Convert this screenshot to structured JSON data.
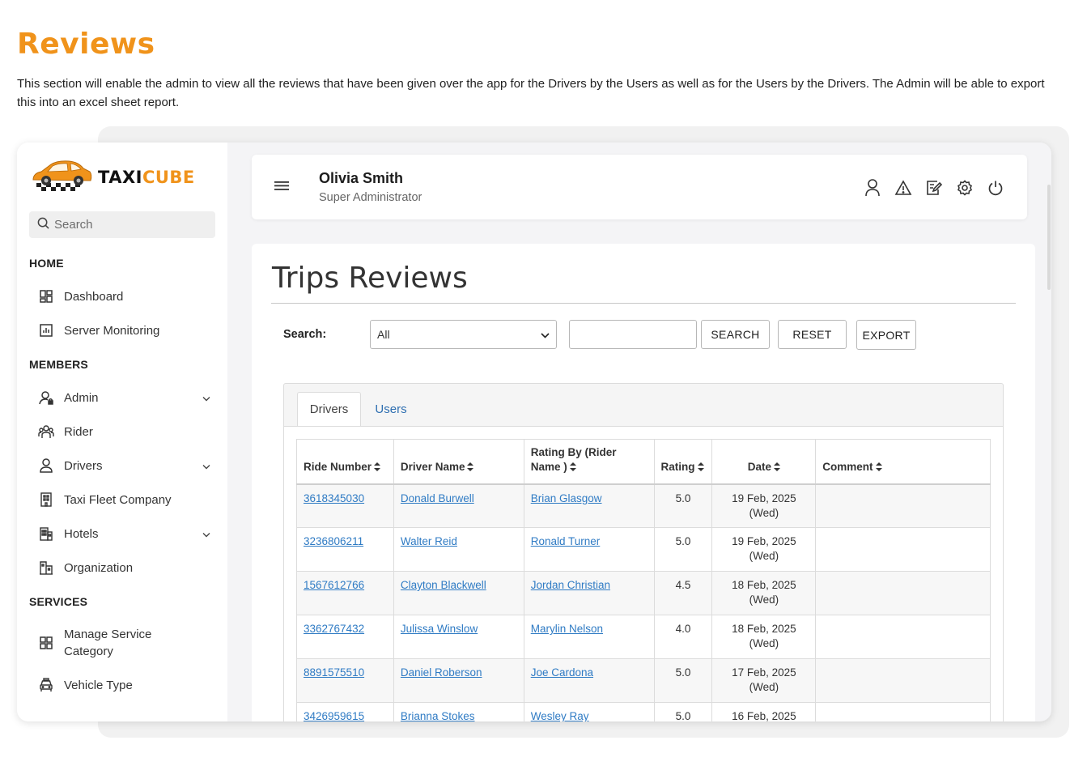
{
  "page": {
    "title": "Reviews",
    "description": "This section will enable the admin to view all the reviews that have been given over the app for the Drivers by the Users as well as for the Users by the Drivers. The Admin will be able to export this into an excel sheet report."
  },
  "colors": {
    "accent": "#f0931b",
    "link": "#2f7bc4"
  },
  "logo": {
    "brand_part1": "TAXI",
    "brand_part2": "CUBE",
    "icon": "taxi-car-logo"
  },
  "sidebar": {
    "search_placeholder": "Search",
    "sections": {
      "home": "HOME",
      "members": "MEMBERS",
      "services": "SERVICES"
    },
    "items": [
      {
        "label": "Dashboard",
        "icon": "dashboard-icon"
      },
      {
        "label": "Server Monitoring",
        "icon": "chart-icon"
      },
      {
        "label": "Admin",
        "icon": "admin-icon"
      },
      {
        "label": "Rider",
        "icon": "rider-group-icon"
      },
      {
        "label": "Drivers",
        "icon": "driver-icon"
      },
      {
        "label": "Taxi Fleet Company",
        "icon": "building-icon"
      },
      {
        "label": "Hotels",
        "icon": "hotel-icon"
      },
      {
        "label": "Organization",
        "icon": "organization-icon"
      },
      {
        "label": "Manage Service Category",
        "icon": "grid-icon"
      },
      {
        "label": "Vehicle Type",
        "icon": "car-icon"
      }
    ]
  },
  "header": {
    "user_name": "Olivia Smith",
    "user_role": "Super Administrator",
    "icons": [
      "profile-icon",
      "warning-icon",
      "edit-icon",
      "settings-icon",
      "power-icon"
    ]
  },
  "main": {
    "title": "Trips Reviews",
    "search_label": "Search:",
    "filter_selected": "All",
    "search_text_value": "",
    "buttons": {
      "search": "SEARCH",
      "reset": "RESET",
      "export": "EXPORT"
    },
    "tabs": [
      {
        "label": "Drivers",
        "active": true
      },
      {
        "label": "Users",
        "active": false
      }
    ],
    "table": {
      "headers": [
        "Ride Number",
        "Driver Name",
        "Rating By (Rider Name )",
        "Rating",
        "Date",
        "Comment"
      ],
      "rows": [
        {
          "ride": "3618345030",
          "driver": "Donald Burwell",
          "rider": "Brian Glasgow",
          "rating": "5.0",
          "date": "19 Feb, 2025",
          "day": "(Wed)",
          "comment": ""
        },
        {
          "ride": "3236806211",
          "driver": "Walter Reid",
          "rider": "Ronald Turner",
          "rating": "5.0",
          "date": "19 Feb, 2025",
          "day": "(Wed)",
          "comment": ""
        },
        {
          "ride": "1567612766",
          "driver": "Clayton Blackwell",
          "rider": "Jordan Christian",
          "rating": "4.5",
          "date": "18 Feb, 2025",
          "day": "(Wed)",
          "comment": ""
        },
        {
          "ride": "3362767432",
          "driver": "Julissa Winslow",
          "rider": "Marylin Nelson",
          "rating": "4.0",
          "date": "18 Feb, 2025",
          "day": "(Wed)",
          "comment": ""
        },
        {
          "ride": "8891575510",
          "driver": "Daniel Roberson",
          "rider": "Joe Cardona",
          "rating": "5.0",
          "date": "17 Feb, 2025",
          "day": "(Wed)",
          "comment": ""
        },
        {
          "ride": "3426959615",
          "driver": "Brianna Stokes",
          "rider": "Wesley Ray",
          "rating": "5.0",
          "date": "16 Feb, 2025",
          "day": "",
          "comment": ""
        }
      ]
    }
  }
}
